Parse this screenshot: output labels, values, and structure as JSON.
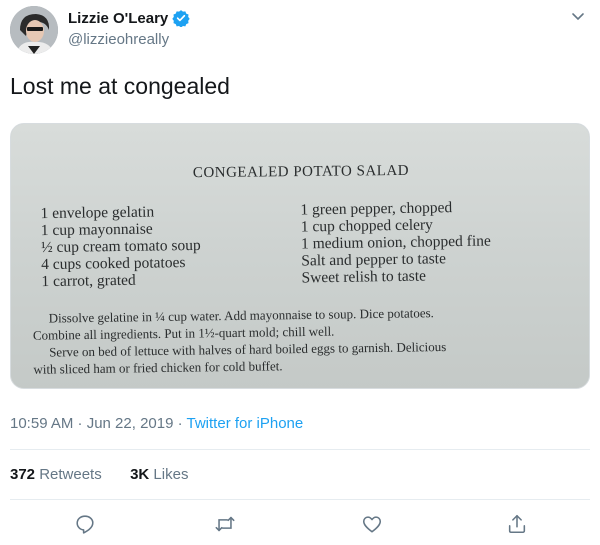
{
  "tweet": {
    "author": {
      "display_name": "Lizzie O'Leary",
      "handle": "@lizzieohreally",
      "verified": true
    },
    "text": "Lost me at congealed",
    "timestamp": "10:59 AM · Jun 22, 2019",
    "source_prefix": " · ",
    "source": "Twitter for iPhone",
    "stats": {
      "retweets_count": "372",
      "retweets_label": " Retweets",
      "likes_count": "3K",
      "likes_label": " Likes"
    }
  },
  "recipe": {
    "title": "CONGEALED POTATO SALAD",
    "ingredients_left": [
      "1 envelope gelatin",
      "1 cup mayonnaise",
      "½ cup cream tomato soup",
      "4 cups cooked potatoes",
      "1 carrot, grated"
    ],
    "ingredients_right": [
      "1 green pepper, chopped",
      "1 cup chopped celery",
      "1 medium onion, chopped fine",
      "Salt and pepper to taste",
      "Sweet relish to taste"
    ],
    "directions": [
      "Dissolve gelatine in ¼ cup water. Add mayonnaise to soup. Dice potatoes.",
      "Combine all ingredients. Put in 1½-quart mold; chill well.",
      "Serve on bed of lettuce with halves of hard boiled eggs to garnish. Delicious",
      "with sliced ham or fried chicken for cold buffet."
    ]
  },
  "colors": {
    "accent": "#1da1f2",
    "secondary_text": "#657786",
    "primary_text": "#14171a"
  },
  "icons": [
    "verified-badge-icon",
    "chevron-down-icon",
    "reply-icon",
    "retweet-icon",
    "like-icon",
    "share-icon"
  ]
}
